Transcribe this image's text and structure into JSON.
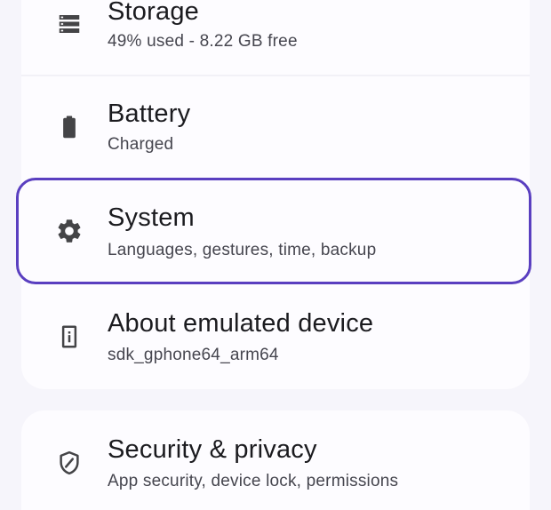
{
  "settings_list": {
    "items": [
      {
        "id": "storage",
        "title": "Storage",
        "subtitle": "49% used - 8.22 GB free",
        "icon": "storage-icon"
      },
      {
        "id": "battery",
        "title": "Battery",
        "subtitle": "Charged",
        "icon": "battery-icon"
      },
      {
        "id": "system",
        "title": "System",
        "subtitle": "Languages, gestures, time, backup",
        "icon": "gear-icon",
        "focused": true
      },
      {
        "id": "about",
        "title": "About emulated device",
        "subtitle": "sdk_gphone64_arm64",
        "icon": "device-info-icon"
      },
      {
        "id": "security",
        "title": "Security & privacy",
        "subtitle": "App security, device lock, permissions",
        "icon": "shield-icon"
      }
    ]
  },
  "colors": {
    "background": "#f6f5fb",
    "card": "#fdfcff",
    "focus_ring": "#5a3fc0",
    "title_text": "#1b1b1f",
    "subtitle_text": "#46464f",
    "icon": "#444447"
  }
}
